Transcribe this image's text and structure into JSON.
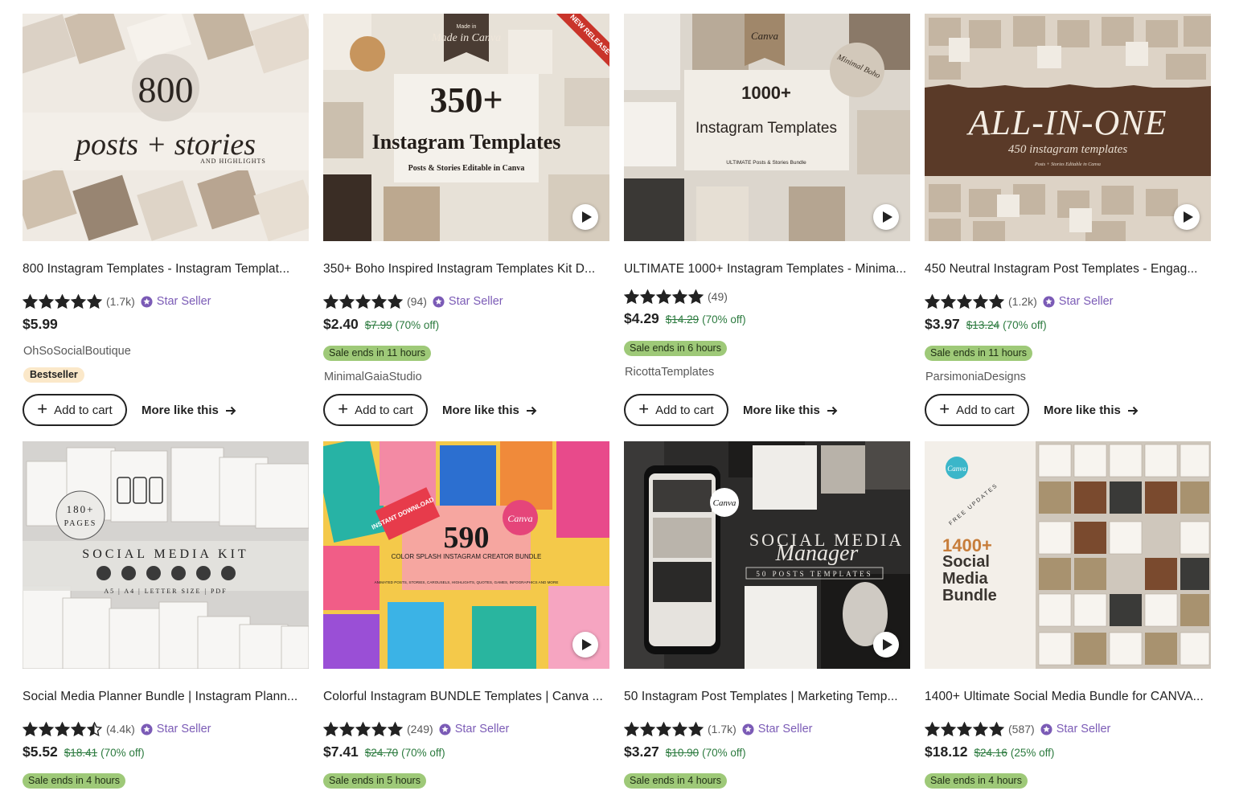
{
  "theme": {
    "star_color": "#222222",
    "star_seller_color": "#7b5bb6",
    "sale_green": "#2b7a3e",
    "sale_badge_bg": "#9ec978",
    "bestseller_bg": "#fbe8c9"
  },
  "listings": [
    {
      "thumb": {
        "overlay_1": "800",
        "overlay_2": "posts + stories",
        "overlay_3": "AND HIGHLIGHTS",
        "has_video": false
      },
      "title": "800 Instagram Templates - Instagram Templat...",
      "rating": 5,
      "review_count": "(1.7k)",
      "star_seller": "Star Seller",
      "price": "$5.99",
      "original_price": "",
      "discount": "",
      "sale_text": "",
      "shop": "OhSoSocialBoutique",
      "badge": "Bestseller",
      "add_to_cart": "Add to cart",
      "more_like_this": "More like this"
    },
    {
      "thumb": {
        "overlay_1": "350+",
        "overlay_2": "Instagram Templates",
        "overlay_3": "Posts & Stories Editable in Canva",
        "corner_label": "Made in Canva",
        "ribbon": "NEW RELEASE",
        "has_video": true
      },
      "title": "350+ Boho Inspired Instagram Templates Kit D...",
      "rating": 5,
      "review_count": "(94)",
      "star_seller": "Star Seller",
      "price": "$2.40",
      "original_price": "$7.99",
      "discount": "(70% off)",
      "sale_text": "Sale ends in 11 hours",
      "shop": "MinimalGaiaStudio",
      "badge": "",
      "add_to_cart": "Add to cart",
      "more_like_this": "More like this"
    },
    {
      "thumb": {
        "overlay_1": "1000+",
        "overlay_2": "Instagram Templates",
        "overlay_3": "ULTIMATE Posts & Stories Bundle",
        "corner_label": "Canva",
        "circle_label": "Minimal Boho",
        "has_video": true
      },
      "title": "ULTIMATE 1000+ Instagram Templates - Minima...",
      "rating": 5,
      "review_count": "(49)",
      "star_seller": "",
      "price": "$4.29",
      "original_price": "$14.29",
      "discount": "(70% off)",
      "sale_text": "Sale ends in 6 hours",
      "shop": "RicottaTemplates",
      "badge": "",
      "add_to_cart": "Add to cart",
      "more_like_this": "More like this"
    },
    {
      "thumb": {
        "overlay_1": "ALL-IN-ONE",
        "overlay_2": "450 instagram templates",
        "overlay_3": "Posts + Stories Editable in Canva",
        "has_video": true
      },
      "title": "450 Neutral Instagram Post Templates - Engag...",
      "rating": 5,
      "review_count": "(1.2k)",
      "star_seller": "Star Seller",
      "price": "$3.97",
      "original_price": "$13.24",
      "discount": "(70% off)",
      "sale_text": "Sale ends in 11 hours",
      "shop": "ParsimoniaDesigns",
      "badge": "",
      "add_to_cart": "Add to cart",
      "more_like_this": "More like this"
    },
    {
      "thumb": {
        "overlay_1": "180+",
        "overlay_2": "PAGES",
        "overlay_3": "SOCIAL MEDIA KIT",
        "overlay_4": "A5 | A4 | LETTER SIZE | PDF",
        "has_video": false
      },
      "title": "Social Media Planner Bundle | Instagram Plann...",
      "rating": 4.5,
      "review_count": "(4.4k)",
      "star_seller": "Star Seller",
      "price": "$5.52",
      "original_price": "$18.41",
      "discount": "(70% off)",
      "sale_text": "Sale ends in 4 hours",
      "shop": "",
      "badge": "",
      "add_to_cart": "",
      "more_like_this": ""
    },
    {
      "thumb": {
        "overlay_1": "590",
        "overlay_2": "COLOR SPLASH INSTAGRAM CREATOR BUNDLE",
        "overlay_3": "ANIMATED POSTS, STORIES, CAROUSELS, HIGHLIGHTS, QUOTES, GAMES, INFOGRAPHICS AND MORE",
        "corner_label": "Canva",
        "ribbon": "INSTANT DOWNLOAD",
        "has_video": true
      },
      "title": "Colorful Instagram BUNDLE Templates | Canva ...",
      "rating": 5,
      "review_count": "(249)",
      "star_seller": "Star Seller",
      "price": "$7.41",
      "original_price": "$24.70",
      "discount": "(70% off)",
      "sale_text": "Sale ends in 5 hours",
      "shop": "",
      "badge": "",
      "add_to_cart": "",
      "more_like_this": ""
    },
    {
      "thumb": {
        "overlay_1": "SOCIAL MEDIA",
        "overlay_2": "Manager",
        "overlay_3": "50 POSTS TEMPLATES",
        "corner_label": "Canva",
        "has_video": true
      },
      "title": "50 Instagram Post Templates | Marketing Temp...",
      "rating": 5,
      "review_count": "(1.7k)",
      "star_seller": "Star Seller",
      "price": "$3.27",
      "original_price": "$10.90",
      "discount": "(70% off)",
      "sale_text": "Sale ends in 4 hours",
      "shop": "",
      "badge": "",
      "add_to_cart": "",
      "more_like_this": ""
    },
    {
      "thumb": {
        "overlay_1": "1400+",
        "overlay_2": "Social Media Bundle",
        "overlay_3": "FREE UPDATES",
        "corner_label": "Canva",
        "has_video": false
      },
      "title": "1400+ Ultimate Social Media Bundle for CANVA...",
      "rating": 5,
      "review_count": "(587)",
      "star_seller": "Star Seller",
      "price": "$18.12",
      "original_price": "$24.16",
      "discount": "(25% off)",
      "sale_text": "Sale ends in 4 hours",
      "shop": "",
      "badge": "",
      "add_to_cart": "",
      "more_like_this": ""
    }
  ]
}
